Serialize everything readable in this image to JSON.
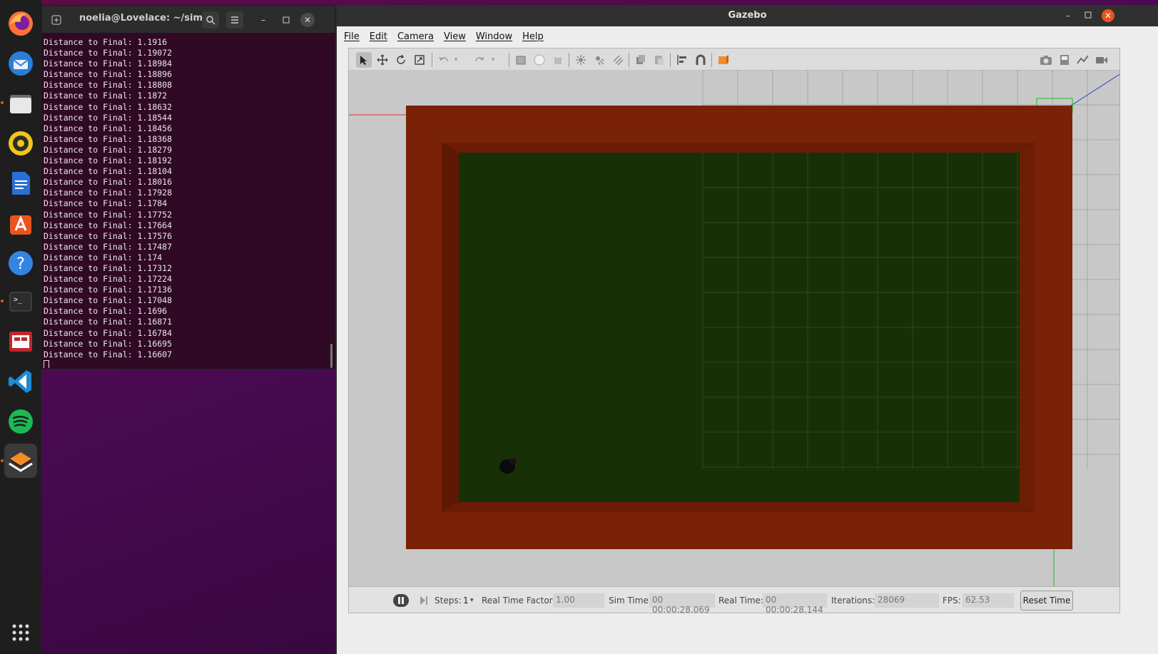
{
  "dock": {
    "items": [
      {
        "name": "firefox-icon",
        "color": "#ff7139"
      },
      {
        "name": "thunderbird-icon",
        "color": "#2a7fd4"
      },
      {
        "name": "files-icon",
        "color": "#e8e8e8"
      },
      {
        "name": "rhythmbox-icon",
        "color": "#f5c518"
      },
      {
        "name": "writer-icon",
        "color": "#2a6fd6"
      },
      {
        "name": "software-center-icon",
        "color": "#e95420"
      },
      {
        "name": "help-icon",
        "color": "#3584e4"
      },
      {
        "name": "terminal-icon",
        "color": "#2c2c2c"
      },
      {
        "name": "screen-recorder-icon",
        "color": "#c0272d"
      },
      {
        "name": "vscode-icon",
        "color": "#1f8ad2"
      },
      {
        "name": "spotify-icon",
        "color": "#1db954"
      },
      {
        "name": "gazebo-icon",
        "color": "#f28c28"
      }
    ],
    "apps_grid": "show-apps-icon"
  },
  "terminal": {
    "title": "noelia@Lovelace: ~/simu...",
    "lines": [
      "Distance to Final: 1.1916",
      "Distance to Final: 1.19072",
      "Distance to Final: 1.18984",
      "Distance to Final: 1.18896",
      "Distance to Final: 1.18808",
      "Distance to Final: 1.1872",
      "Distance to Final: 1.18632",
      "Distance to Final: 1.18544",
      "Distance to Final: 1.18456",
      "Distance to Final: 1.18368",
      "Distance to Final: 1.18279",
      "Distance to Final: 1.18192",
      "Distance to Final: 1.18104",
      "Distance to Final: 1.18016",
      "Distance to Final: 1.17928",
      "Distance to Final: 1.1784",
      "Distance to Final: 1.17752",
      "Distance to Final: 1.17664",
      "Distance to Final: 1.17576",
      "Distance to Final: 1.17487",
      "Distance to Final: 1.174",
      "Distance to Final: 1.17312",
      "Distance to Final: 1.17224",
      "Distance to Final: 1.17136",
      "Distance to Final: 1.17048",
      "Distance to Final: 1.1696",
      "Distance to Final: 1.16871",
      "Distance to Final: 1.16784",
      "Distance to Final: 1.16695",
      "Distance to Final: 1.16607"
    ]
  },
  "gazebo": {
    "title": "Gazebo",
    "menu": [
      "File",
      "Edit",
      "Camera",
      "View",
      "Window",
      "Help"
    ],
    "bottom": {
      "steps_label": "Steps:",
      "steps_value": "1",
      "rtf_label": "Real Time Factor:",
      "rtf_value": "1.00",
      "sim_time_label": "Sim Time:",
      "sim_time_value": "00 00:00:28.069",
      "real_time_label": "Real Time:",
      "real_time_value": "00 00:00:28.144",
      "iterations_label": "Iterations:",
      "iterations_value": "28069",
      "fps_label": "FPS:",
      "fps_value": "62.53",
      "reset_label": "Reset Time"
    },
    "colors": {
      "wall": "#7a2208",
      "floor": "#183008",
      "background": "#c8c8c8"
    }
  }
}
